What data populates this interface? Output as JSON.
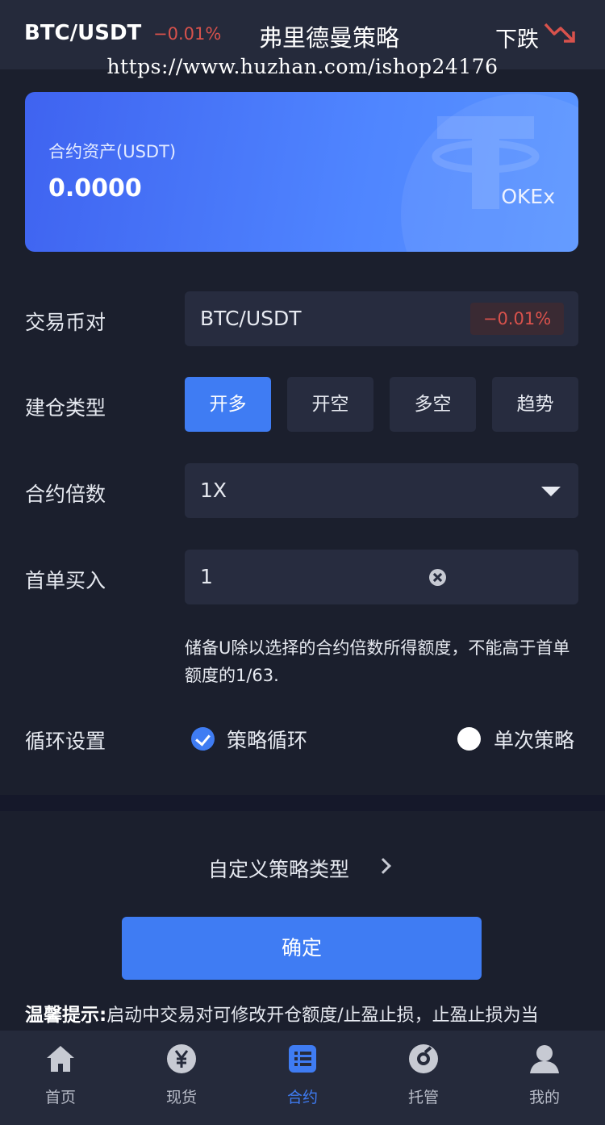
{
  "header": {
    "pair": "BTC/USDT",
    "change": "−0.01%",
    "title": "弗里德曼策略",
    "trend_label": "下跌",
    "trend_icon": "trend-down-icon",
    "watermark": "https://www.huzhan.com/ishop24176"
  },
  "asset_card": {
    "label": "合约资产(USDT)",
    "value": "0.0000",
    "exchange": "OKEx"
  },
  "form": {
    "pair_label": "交易币对",
    "pair_value": "BTC/USDT",
    "pair_change": "−0.01%",
    "position_type_label": "建仓类型",
    "position_types": [
      "开多",
      "开空",
      "多空",
      "趋势"
    ],
    "selected_position_type": "开多",
    "leverage_label": "合约倍数",
    "leverage_value": "1X",
    "first_buy_label": "首单买入",
    "first_buy_value": "1",
    "hint": "储备U除以选择的合约倍数所得额度，不能高于首单额度的1/63.",
    "cycle_label": "循环设置",
    "cycle_options": [
      "策略循环",
      "单次策略"
    ],
    "cycle_selected": "策略循环"
  },
  "custom_strategy": {
    "label": "自定义策略类型"
  },
  "confirm_button": {
    "label": "确定"
  },
  "tip": {
    "title": "温馨提示:",
    "text": "启动中交易对可修改开仓额度/止盈止损，止盈止损为当"
  },
  "tabbar": {
    "items": [
      {
        "label": "首页",
        "icon": "home-icon"
      },
      {
        "label": "现货",
        "icon": "yuan-icon"
      },
      {
        "label": "合约",
        "icon": "list-icon"
      },
      {
        "label": "托管",
        "icon": "custody-icon"
      },
      {
        "label": "我的",
        "icon": "user-icon"
      }
    ],
    "active": "合约"
  },
  "colors": {
    "background": "#1b1f2d",
    "panel": "#272c3f",
    "accent": "#3f7cf3",
    "negative": "#d8524c"
  }
}
